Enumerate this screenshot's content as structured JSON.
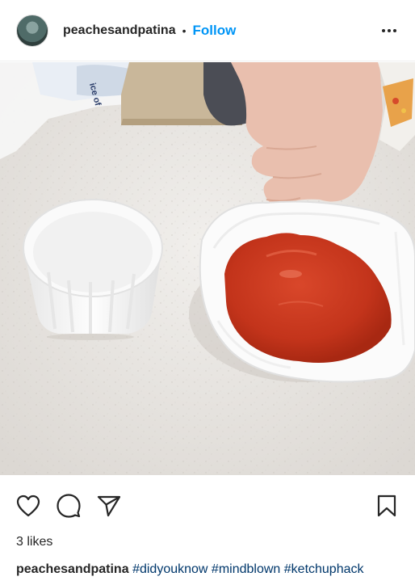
{
  "header": {
    "username": "peachesandpatina",
    "separator": "•",
    "follow_label": "Follow"
  },
  "photo": {
    "cup_print_fragment": "ice of"
  },
  "likes": {
    "text": "3 likes"
  },
  "caption": {
    "username": "peachesandpatina",
    "hashtags": [
      "#didyouknow",
      "#mindblown",
      "#ketchuphack"
    ]
  },
  "icons": {
    "like": "heart-icon",
    "comment": "comment-icon",
    "share": "send-icon",
    "save": "bookmark-icon",
    "more": "more-options-icon"
  },
  "colors": {
    "accent": "#0095f6",
    "hashtag": "#00376b",
    "ketchup": "#c8361d"
  }
}
